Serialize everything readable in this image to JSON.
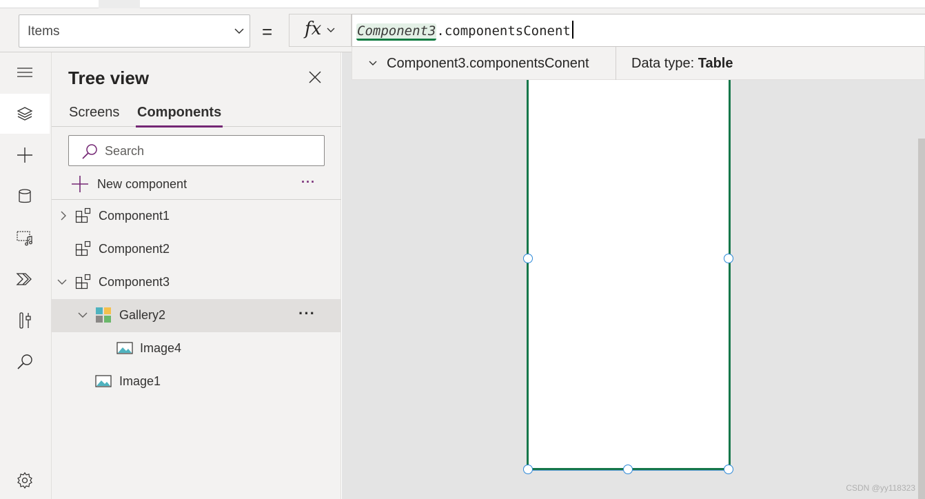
{
  "formula_bar": {
    "property": "Items",
    "equals": "=",
    "fx_label": "fx",
    "formula_identifier": "Component3",
    "formula_rest": ".componentsConent"
  },
  "intellisense": {
    "suggestion": "Component3.componentsConent",
    "data_type_label": "Data type:",
    "data_type_value": "Table"
  },
  "rail": {
    "icons": [
      "hamburger-icon",
      "layers-icon",
      "plus-icon",
      "database-icon",
      "media-icon",
      "power-automate-icon",
      "tools-icon",
      "search-icon",
      "settings-icon"
    ],
    "active": "layers-icon"
  },
  "tree_view": {
    "title": "Tree view",
    "tabs": [
      "Screens",
      "Components"
    ],
    "active_tab": "Components",
    "search_placeholder": "Search",
    "new_component_label": "New component",
    "items": [
      {
        "label": "Component1",
        "type": "component",
        "expander": "collapsed",
        "level": 0
      },
      {
        "label": "Component2",
        "type": "component",
        "expander": "none",
        "level": 0
      },
      {
        "label": "Component3",
        "type": "component",
        "expander": "expanded",
        "level": 0
      },
      {
        "label": "Gallery2",
        "type": "gallery",
        "expander": "expanded",
        "level": 1,
        "selected": true
      },
      {
        "label": "Image4",
        "type": "image",
        "expander": "none",
        "level": 2
      },
      {
        "label": "Image1",
        "type": "image",
        "expander": "none",
        "level": 1
      }
    ]
  },
  "colors": {
    "accent": "#742774",
    "selection_border": "#16774a",
    "handle": "#2b88d8"
  },
  "watermark": "CSDN @yy118323"
}
